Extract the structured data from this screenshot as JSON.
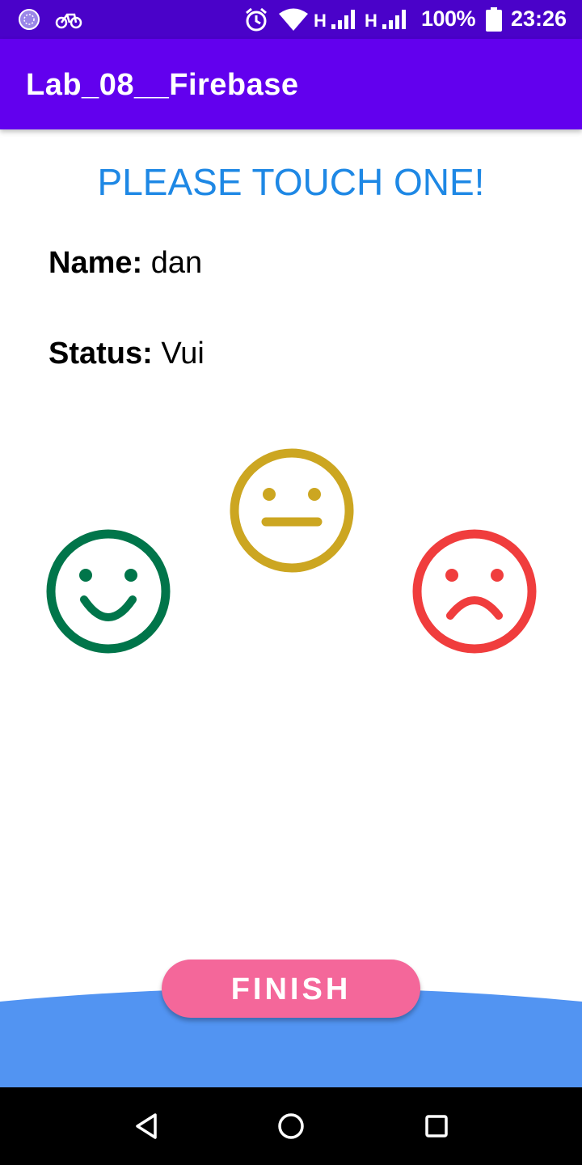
{
  "status_bar": {
    "network_1": "H",
    "network_2": "H",
    "battery": "100%",
    "time": "23:26"
  },
  "app_bar": {
    "title": "Lab_08__Firebase"
  },
  "main": {
    "prompt": "PLEASE TOUCH ONE!",
    "name_label": "Name:",
    "name_value": "dan",
    "status_label": "Status:",
    "status_value": "Vui",
    "faces": [
      {
        "icon": "happy-face-icon",
        "color": "#00754a"
      },
      {
        "icon": "neutral-face-icon",
        "color": "#cca621"
      },
      {
        "icon": "sad-face-icon",
        "color": "#f03d3d"
      }
    ]
  },
  "footer": {
    "finish_label": "FINISH",
    "button_color": "#f4679a",
    "wave_color": "#5294f2"
  },
  "nav_bar": {
    "icons": [
      "back-icon",
      "home-icon",
      "recents-icon"
    ]
  }
}
